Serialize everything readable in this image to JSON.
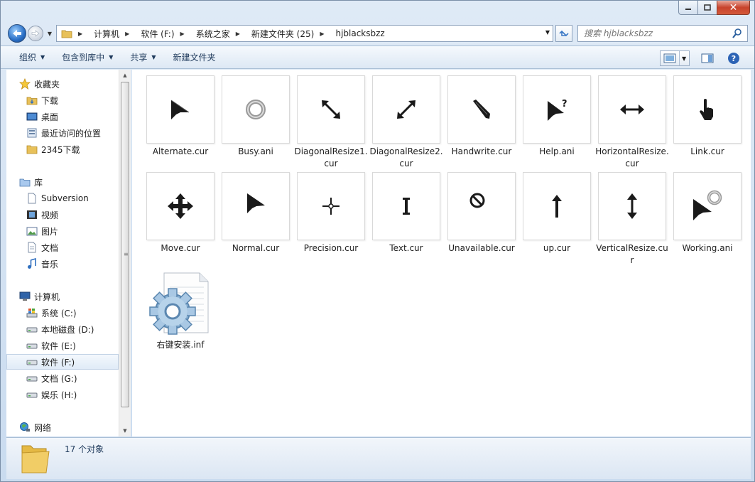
{
  "breadcrumbs": [
    "计算机",
    "软件 (F:)",
    "系统之家",
    "新建文件夹 (25)",
    "hjblacksbzz"
  ],
  "search": {
    "placeholder": "搜索 hjblacksbzz"
  },
  "toolbar": {
    "organize": "组织",
    "include_in_library": "包含到库中",
    "share": "共享",
    "new_folder": "新建文件夹"
  },
  "nav": {
    "favorites": {
      "title": "收藏夹",
      "items": [
        "下载",
        "桌面",
        "最近访问的位置",
        "2345下载"
      ]
    },
    "libraries": {
      "title": "库",
      "items": [
        "Subversion",
        "视频",
        "图片",
        "文档",
        "音乐"
      ]
    },
    "computer": {
      "title": "计算机",
      "items": [
        "系统 (C:)",
        "本地磁盘 (D:)",
        "软件 (E:)",
        "软件 (F:)",
        "文档 (G:)",
        "娱乐 (H:)"
      ],
      "selected": "软件 (F:)"
    },
    "network": {
      "title": "网络"
    }
  },
  "files": [
    {
      "name": "Alternate.cur",
      "icon": "alternate-cursor-icon"
    },
    {
      "name": "Busy.ani",
      "icon": "busy-ring-icon"
    },
    {
      "name": "DiagonalResize1.cur",
      "icon": "diagonal-resize1-icon"
    },
    {
      "name": "DiagonalResize2.cur",
      "icon": "diagonal-resize2-icon"
    },
    {
      "name": "Handwrite.cur",
      "icon": "handwrite-pen-icon"
    },
    {
      "name": "Help.ani",
      "icon": "help-cursor-icon"
    },
    {
      "name": "HorizontalResize.cur",
      "icon": "horizontal-resize-icon"
    },
    {
      "name": "Link.cur",
      "icon": "hand-pointer-icon"
    },
    {
      "name": "Move.cur",
      "icon": "move-cross-icon"
    },
    {
      "name": "Normal.cur",
      "icon": "arrow-cursor-icon"
    },
    {
      "name": "Precision.cur",
      "icon": "precision-crosshair-icon"
    },
    {
      "name": "Text.cur",
      "icon": "text-ibeam-icon"
    },
    {
      "name": "Unavailable.cur",
      "icon": "unavailable-icon"
    },
    {
      "name": "up.cur",
      "icon": "up-arrow-icon"
    },
    {
      "name": "VerticalResize.cur",
      "icon": "vertical-resize-icon"
    },
    {
      "name": "Working.ani",
      "icon": "working-cursor-icon"
    },
    {
      "name": "右键安装.inf",
      "icon": "inf-settings-file-icon"
    }
  ],
  "status": {
    "count": "17 个对象"
  },
  "colors": {
    "accent": "#2a6fc6",
    "cursor": "#1a1a1a",
    "selection": "#e0ebf7"
  }
}
